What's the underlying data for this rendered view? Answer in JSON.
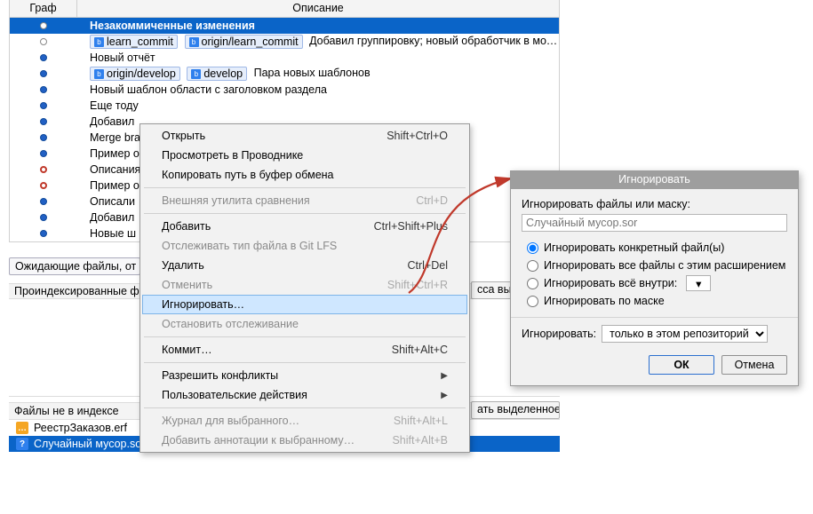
{
  "columns": {
    "graph": "Граф",
    "desc": "Описание"
  },
  "rows": {
    "uncommitted": "Незакоммиченные изменения",
    "r1_tag1": "learn_commit",
    "r1_tag2": "origin/learn_commit",
    "r1_msg": "Добавил группировку; новый обработчик в моду.",
    "r2": "Новый отчёт",
    "r3_tag1": "origin/develop",
    "r3_tag2": "develop",
    "r3_msg": "Пара новых шаблонов",
    "r4": "Новый шаблон области с заголовком раздела",
    "r5": "Еще тоду",
    "r6": "Добавил",
    "r7": "Merge bra",
    "r8": "Пример о",
    "r9": "Описания",
    "r10": "Пример о",
    "r11": "Описали",
    "r12": "Добавил",
    "r13": "Новые ш"
  },
  "pending_btn": "Ожидающие файлы, от",
  "indexed_header": "Проиндексированные ф",
  "peek1": "сса выд",
  "peek2": "ать выделенное",
  "noindex_header": "Файлы не в индексе",
  "files": {
    "f1": "РеестрЗаказов.erf",
    "f2": "Случайный мусор.sor"
  },
  "menu": {
    "open": "Открыть",
    "open_sc": "Shift+Ctrl+O",
    "explorer": "Просмотреть в Проводнике",
    "copypath": "Копировать путь в буфер обмена",
    "diff": "Внешняя утилита сравнения",
    "diff_sc": "Ctrl+D",
    "add": "Добавить",
    "add_sc": "Ctrl+Shift+Plus",
    "lfs": "Отслеживать тип файла в Git LFS",
    "del": "Удалить",
    "del_sc": "Ctrl+Del",
    "revert": "Отменить",
    "revert_sc": "Shift+Ctrl+R",
    "ignore": "Игнорировать…",
    "untrack": "Остановить отслеживание",
    "commit": "Коммит…",
    "commit_sc": "Shift+Alt+C",
    "resolve": "Разрешить конфликты",
    "custom": "Пользовательские действия",
    "log": "Журнал для выбранного…",
    "log_sc": "Shift+Alt+L",
    "blame": "Добавить аннотации к выбранному…",
    "blame_sc": "Shift+Alt+B"
  },
  "dialog": {
    "title": "Игнорировать",
    "mask_label": "Игнорировать файлы или маску:",
    "mask_value": "Случайный мусор.sor",
    "opt1": "Игнорировать конкретный файл(ы)",
    "opt2": "Игнорировать все файлы с этим расширением",
    "opt3": "Игнорировать всё внутри:",
    "opt4": "Игнорировать по маске",
    "ignore_in_label": "Игнорировать:",
    "ignore_in_value": "только в этом репозиторий",
    "ok": "ОК",
    "cancel": "Отмена"
  }
}
